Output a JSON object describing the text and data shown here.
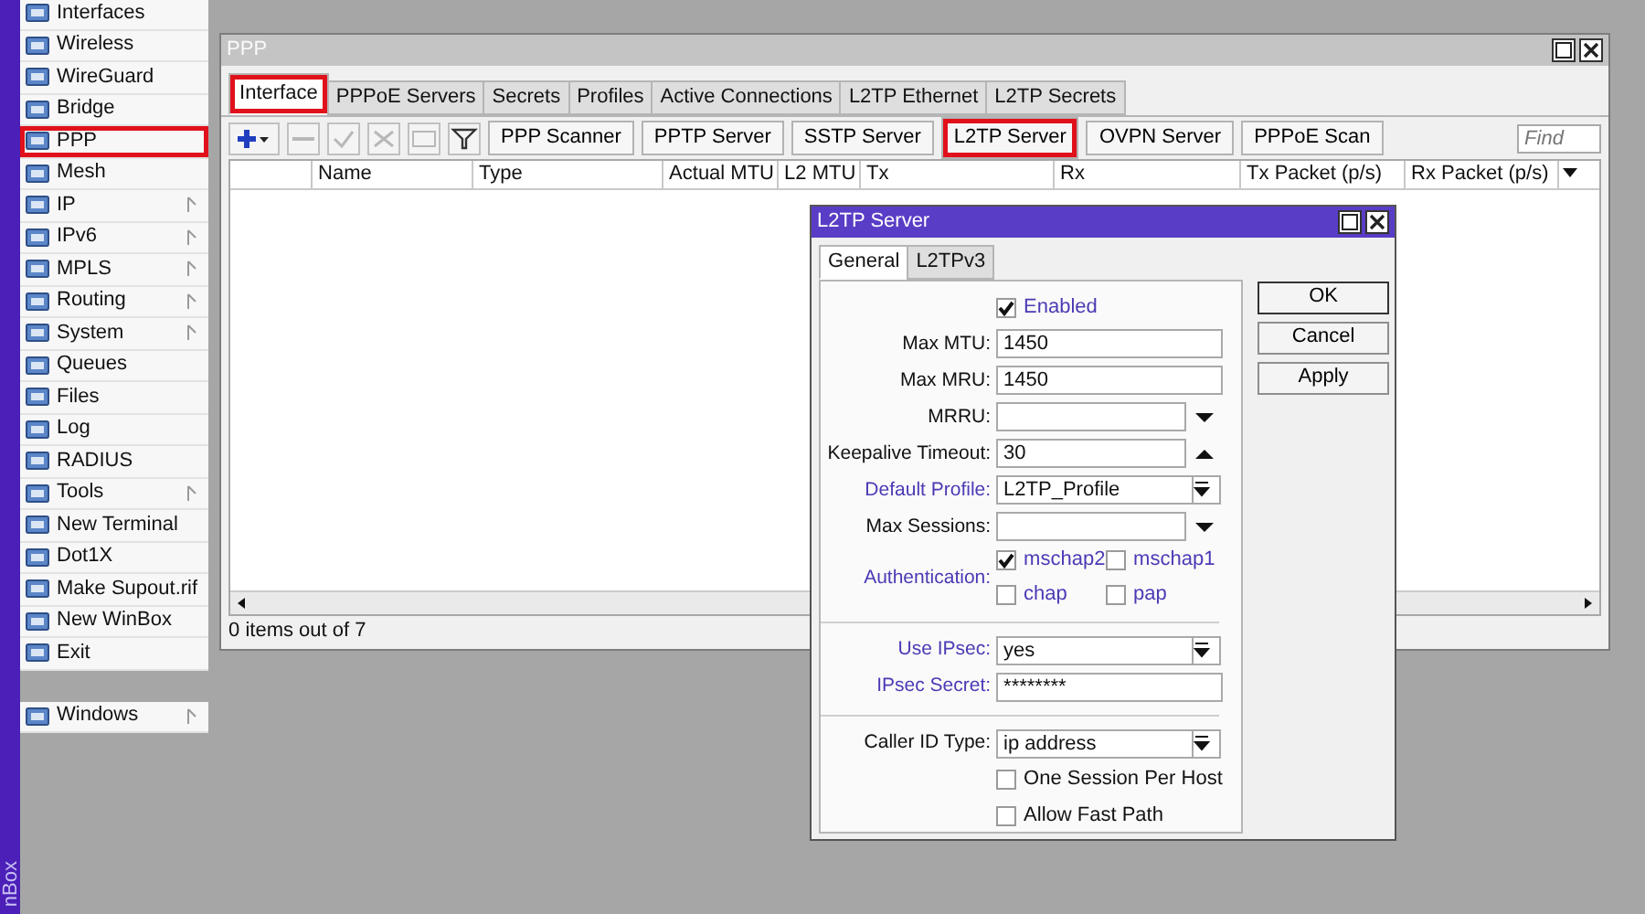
{
  "brand_strip": {
    "text": "nBox"
  },
  "sidebar": {
    "items": [
      {
        "label": "Interfaces",
        "submenu": false,
        "highlighted": false
      },
      {
        "label": "Wireless",
        "submenu": false,
        "highlighted": false
      },
      {
        "label": "WireGuard",
        "submenu": false,
        "highlighted": false
      },
      {
        "label": "Bridge",
        "submenu": false,
        "highlighted": false
      },
      {
        "label": "PPP",
        "submenu": false,
        "highlighted": true
      },
      {
        "label": "Mesh",
        "submenu": false,
        "highlighted": false
      },
      {
        "label": "IP",
        "submenu": true,
        "highlighted": false
      },
      {
        "label": "IPv6",
        "submenu": true,
        "highlighted": false
      },
      {
        "label": "MPLS",
        "submenu": true,
        "highlighted": false
      },
      {
        "label": "Routing",
        "submenu": true,
        "highlighted": false
      },
      {
        "label": "System",
        "submenu": true,
        "highlighted": false
      },
      {
        "label": "Queues",
        "submenu": false,
        "highlighted": false
      },
      {
        "label": "Files",
        "submenu": false,
        "highlighted": false
      },
      {
        "label": "Log",
        "submenu": false,
        "highlighted": false
      },
      {
        "label": "RADIUS",
        "submenu": false,
        "highlighted": false
      },
      {
        "label": "Tools",
        "submenu": true,
        "highlighted": false
      },
      {
        "label": "New Terminal",
        "submenu": false,
        "highlighted": false
      },
      {
        "label": "Dot1X",
        "submenu": false,
        "highlighted": false
      },
      {
        "label": "Make Supout.rif",
        "submenu": false,
        "highlighted": false
      },
      {
        "label": "New WinBox",
        "submenu": false,
        "highlighted": false
      },
      {
        "label": "Exit",
        "submenu": false,
        "highlighted": false
      }
    ],
    "footer_items": [
      {
        "label": "Windows",
        "submenu": true,
        "highlighted": false
      }
    ]
  },
  "ppp_window": {
    "title": "PPP",
    "tabs": [
      {
        "label": "Interface",
        "selected": true,
        "highlighted": true
      },
      {
        "label": "PPPoE Servers",
        "selected": false,
        "highlighted": false
      },
      {
        "label": "Secrets",
        "selected": false,
        "highlighted": false
      },
      {
        "label": "Profiles",
        "selected": false,
        "highlighted": false
      },
      {
        "label": "Active Connections",
        "selected": false,
        "highlighted": false
      },
      {
        "label": "L2TP Ethernet",
        "selected": false,
        "highlighted": false
      },
      {
        "label": "L2TP Secrets",
        "selected": false,
        "highlighted": false
      }
    ],
    "toolbar": {
      "tools": [
        {
          "kind": "add",
          "disabled": false
        },
        {
          "kind": "remove",
          "disabled": true
        },
        {
          "kind": "enable",
          "disabled": true
        },
        {
          "kind": "disable",
          "disabled": true
        },
        {
          "kind": "comment",
          "disabled": true
        },
        {
          "kind": "filter",
          "disabled": false
        }
      ],
      "buttons": [
        {
          "label": "PPP Scanner",
          "highlighted": false
        },
        {
          "label": "PPTP Server",
          "highlighted": false
        },
        {
          "label": "SSTP Server",
          "highlighted": false
        },
        {
          "label": "L2TP Server",
          "highlighted": true
        },
        {
          "label": "OVPN Server",
          "highlighted": false
        },
        {
          "label": "PPPoE Scan",
          "highlighted": false
        }
      ],
      "find": {
        "placeholder": "Find"
      }
    },
    "table": {
      "columns": [
        "Name",
        "Type",
        "Actual MTU",
        "L2 MTU",
        "Tx",
        "Rx",
        "Tx Packet (p/s)",
        "Rx Packet (p/s)"
      ]
    },
    "status": "0 items out of 7"
  },
  "dialog": {
    "title": "L2TP Server",
    "tabs": [
      {
        "label": "General",
        "selected": true
      },
      {
        "label": "L2TPv3",
        "selected": false
      }
    ],
    "fields": [
      {
        "kind": "checkbox",
        "label": "Enabled",
        "checked": true,
        "emphasized": true
      },
      {
        "kind": "text",
        "label": "Max MTU:",
        "value": "1450",
        "emphasized": false
      },
      {
        "kind": "text",
        "label": "Max MRU:",
        "value": "1450",
        "emphasized": false
      },
      {
        "kind": "dropdown",
        "label": "MRRU:",
        "emphasized": false
      },
      {
        "kind": "spinner",
        "label": "Keepalive Timeout:",
        "value": "30",
        "emphasized": false
      },
      {
        "kind": "select",
        "label": "Default Profile:",
        "value": "L2TP_Profile",
        "emphasized": true
      },
      {
        "kind": "dropdown",
        "label": "Max Sessions:",
        "emphasized": false
      },
      {
        "kind": "checkgroup",
        "label": "Authentication:",
        "emphasized": true,
        "options": [
          {
            "label": "mschap2",
            "checked": true
          },
          {
            "label": "mschap1",
            "checked": false
          },
          {
            "label": "chap",
            "checked": false
          },
          {
            "label": "pap",
            "checked": false
          }
        ]
      },
      {
        "kind": "separator"
      },
      {
        "kind": "select",
        "label": "Use IPsec:",
        "value": "yes",
        "emphasized": true
      },
      {
        "kind": "text",
        "label": "IPsec Secret:",
        "value": "********",
        "emphasized": true
      },
      {
        "kind": "separator"
      },
      {
        "kind": "select",
        "label": "Caller ID Type:",
        "value": "ip address",
        "emphasized": false
      },
      {
        "kind": "checkbox",
        "label": "One Session Per Host",
        "checked": false,
        "emphasized": false
      },
      {
        "kind": "checkbox",
        "label": "Allow Fast Path",
        "checked": false,
        "emphasized": false
      }
    ],
    "buttons": [
      "OK",
      "Cancel",
      "Apply"
    ]
  }
}
